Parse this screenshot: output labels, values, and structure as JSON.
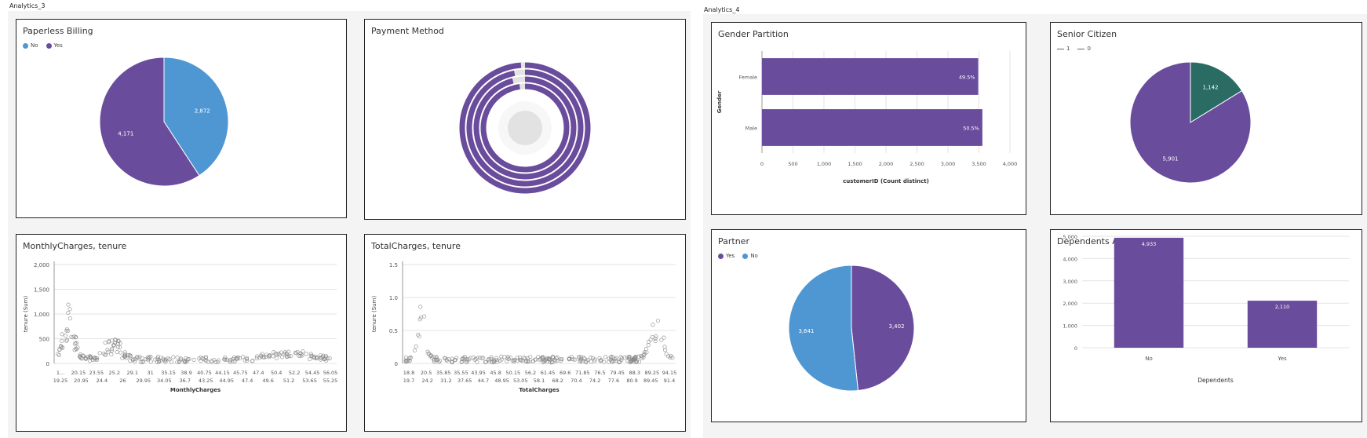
{
  "colors": {
    "purple": "#6a4c9c",
    "blue": "#4f97d3",
    "teal": "#2a6b64",
    "grid": "#e3e3e3",
    "ring_track": "#e3e3e3"
  },
  "dashboards": [
    {
      "label": "Analytics_3"
    },
    {
      "label": "Analytics_4"
    }
  ],
  "paperless": {
    "title": "Paperless Billing",
    "legend": [
      {
        "label": "No",
        "color": "#4f97d3"
      },
      {
        "label": "Yes",
        "color": "#6a4c9c"
      }
    ]
  },
  "payment": {
    "title": "Payment Method"
  },
  "monthly": {
    "title": "MonthlyCharges, tenure"
  },
  "total": {
    "title": "TotalCharges, tenure"
  },
  "gender": {
    "title": "Gender Partition"
  },
  "senior": {
    "title": "Senior Citizen",
    "legend": [
      {
        "label": "1",
        "color": "#2a6b64"
      },
      {
        "label": "0",
        "color": "#6a4c9c"
      }
    ]
  },
  "partner": {
    "title": "Partner",
    "legend": [
      {
        "label": "Yes",
        "color": "#6a4c9c"
      },
      {
        "label": "No",
        "color": "#4f97d3"
      }
    ]
  },
  "dependents": {
    "title": "Dependents Availability"
  },
  "chart_data": [
    {
      "id": "paperless",
      "type": "pie",
      "slices": [
        {
          "label": "No",
          "value": 2872
        },
        {
          "label": "Yes",
          "value": 4171
        }
      ],
      "data_labels": [
        "2,872",
        "4,171"
      ]
    },
    {
      "id": "payment",
      "type": "radial-bar",
      "rings": [
        {
          "fraction": 0.99
        },
        {
          "fraction": 0.97
        },
        {
          "fraction": 0.96
        },
        {
          "fraction": 0.98
        }
      ]
    },
    {
      "id": "monthly",
      "type": "scatter",
      "xlabel": "MonthlyCharges",
      "ylabel": "tenure (Sum)",
      "ylim": [
        0,
        2000
      ],
      "y_ticks": [
        "0",
        "500",
        "1,000",
        "1,500",
        "2,000"
      ],
      "x_ticks_row1": [
        "1...",
        "20.15",
        "23.55",
        "25.2",
        "29.1",
        "31",
        "35.15",
        "38.9",
        "40.75",
        "44.15",
        "45.75",
        "47.4",
        "50.4",
        "52.2",
        "54.45",
        "56.05"
      ],
      "x_ticks_row2": [
        "19.25",
        "20.95",
        "24.4",
        "26",
        "29.95",
        "34.05",
        "36.7",
        "43.25",
        "44.95",
        "47.4",
        "49.6",
        "51.2",
        "53.65",
        "55.25"
      ]
    },
    {
      "id": "total",
      "type": "scatter",
      "xlabel": "TotalCharges",
      "ylabel": "tenure (Sum)",
      "ylim": [
        0,
        1.5
      ],
      "y_ticks": [
        "0",
        "0.5",
        "1.0",
        "1.5"
      ],
      "x_ticks_row1": [
        "18.8",
        "20.5",
        "35.85",
        "35.55",
        "43.95",
        "45.8",
        "50.15",
        "56.2",
        "61.45",
        "69.6",
        "71.85",
        "76.5",
        "79.45",
        "88.3",
        "89.25",
        "94.15"
      ],
      "x_ticks_row2": [
        "19.7",
        "24.2",
        "31.2",
        "37.65",
        "44.7",
        "48.95",
        "53.05",
        "58.1",
        "68.2",
        "70.4",
        "74.2",
        "77.6",
        "80.9",
        "89.45",
        "91.4"
      ]
    },
    {
      "id": "gender",
      "type": "bar",
      "orientation": "horizontal",
      "categories": [
        "Female",
        "Male"
      ],
      "values": [
        3488,
        3555
      ],
      "data_labels": [
        "49.5%",
        "50.5%"
      ],
      "xlabel": "customerID (Count distinct)",
      "ylabel": "Gender",
      "xlim": [
        0,
        4000
      ],
      "x_ticks": [
        "0",
        "500",
        "1,000",
        "1,500",
        "2,000",
        "2,500",
        "3,000",
        "3,500",
        "4,000"
      ]
    },
    {
      "id": "senior",
      "type": "pie",
      "slices": [
        {
          "label": "1",
          "value": 1142
        },
        {
          "label": "0",
          "value": 5901
        }
      ],
      "data_labels": [
        "1,142",
        "5,901"
      ]
    },
    {
      "id": "partner",
      "type": "pie",
      "slices": [
        {
          "label": "Yes",
          "value": 3402
        },
        {
          "label": "No",
          "value": 3641
        }
      ],
      "data_labels": [
        "3,402",
        "3,641"
      ]
    },
    {
      "id": "dependents",
      "type": "bar",
      "categories": [
        "No",
        "Yes"
      ],
      "values": [
        4933,
        2110
      ],
      "data_labels": [
        "4,933",
        "2,110"
      ],
      "xlabel": "Dependents",
      "ylabel": "",
      "ylim": [
        0,
        5000
      ],
      "y_ticks": [
        "0",
        "1,000",
        "2,000",
        "3,000",
        "4,000",
        "5,000"
      ]
    }
  ]
}
